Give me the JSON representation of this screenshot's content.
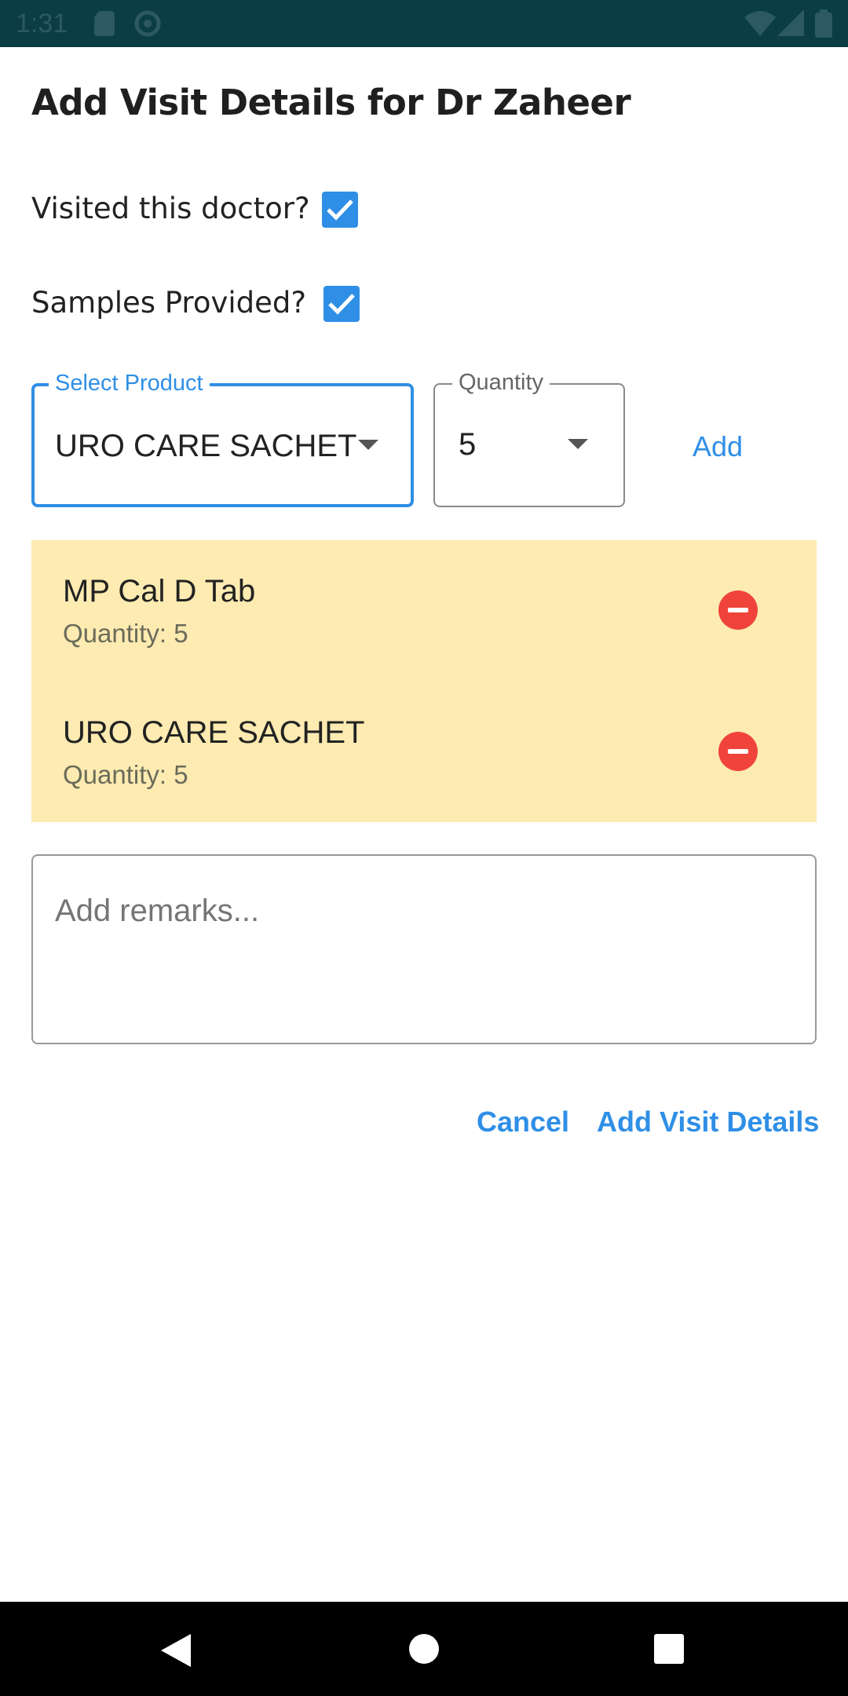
{
  "status_bar": {
    "time": "1:31",
    "icons": [
      "sd-card-icon",
      "sync-icon",
      "wifi-icon",
      "signal-icon",
      "battery-icon"
    ]
  },
  "dialog": {
    "title": "Add Visit Details for Dr Zaheer",
    "visited_label": "Visited this doctor?",
    "visited_checked": true,
    "samples_label": "Samples Provided?",
    "samples_checked": true,
    "product_select": {
      "label": "Select Product",
      "value": "URO CARE SACHET"
    },
    "quantity_select": {
      "label": "Quantity",
      "value": "5"
    },
    "add_label": "Add",
    "items": [
      {
        "name": "MP Cal D Tab",
        "quantity_text": "Quantity: 5"
      },
      {
        "name": "URO CARE SACHET",
        "quantity_text": "Quantity: 5"
      }
    ],
    "remarks_placeholder": "Add remarks...",
    "cancel_label": "Cancel",
    "submit_label": "Add Visit Details"
  },
  "colors": {
    "accent": "#2f8fe6",
    "status_bar_bg": "#0b3d45",
    "list_bg": "#fdebb1",
    "remove_red": "#f0443a"
  }
}
